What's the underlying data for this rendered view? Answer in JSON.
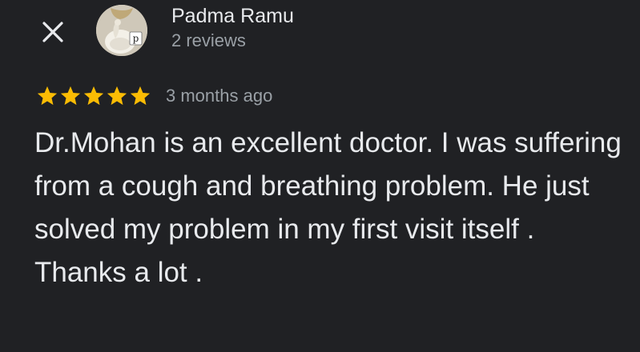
{
  "reviewer": {
    "name": "Padma Ramu",
    "review_count": "2 reviews",
    "avatar_letter": "p"
  },
  "review": {
    "rating": 5,
    "rating_max": 5,
    "time_ago": "3 months ago",
    "text": "Dr.Mohan is an excellent doctor. I was suffering from a cough and breathing problem. He just solved my problem in my first visit itself . Thanks a lot ."
  },
  "icons": {
    "close": "close-icon",
    "star": "star-icon"
  },
  "colors": {
    "background": "#202124",
    "primary_text": "#e8eaed",
    "secondary_text": "#9aa0a6",
    "star": "#fbbc04"
  }
}
